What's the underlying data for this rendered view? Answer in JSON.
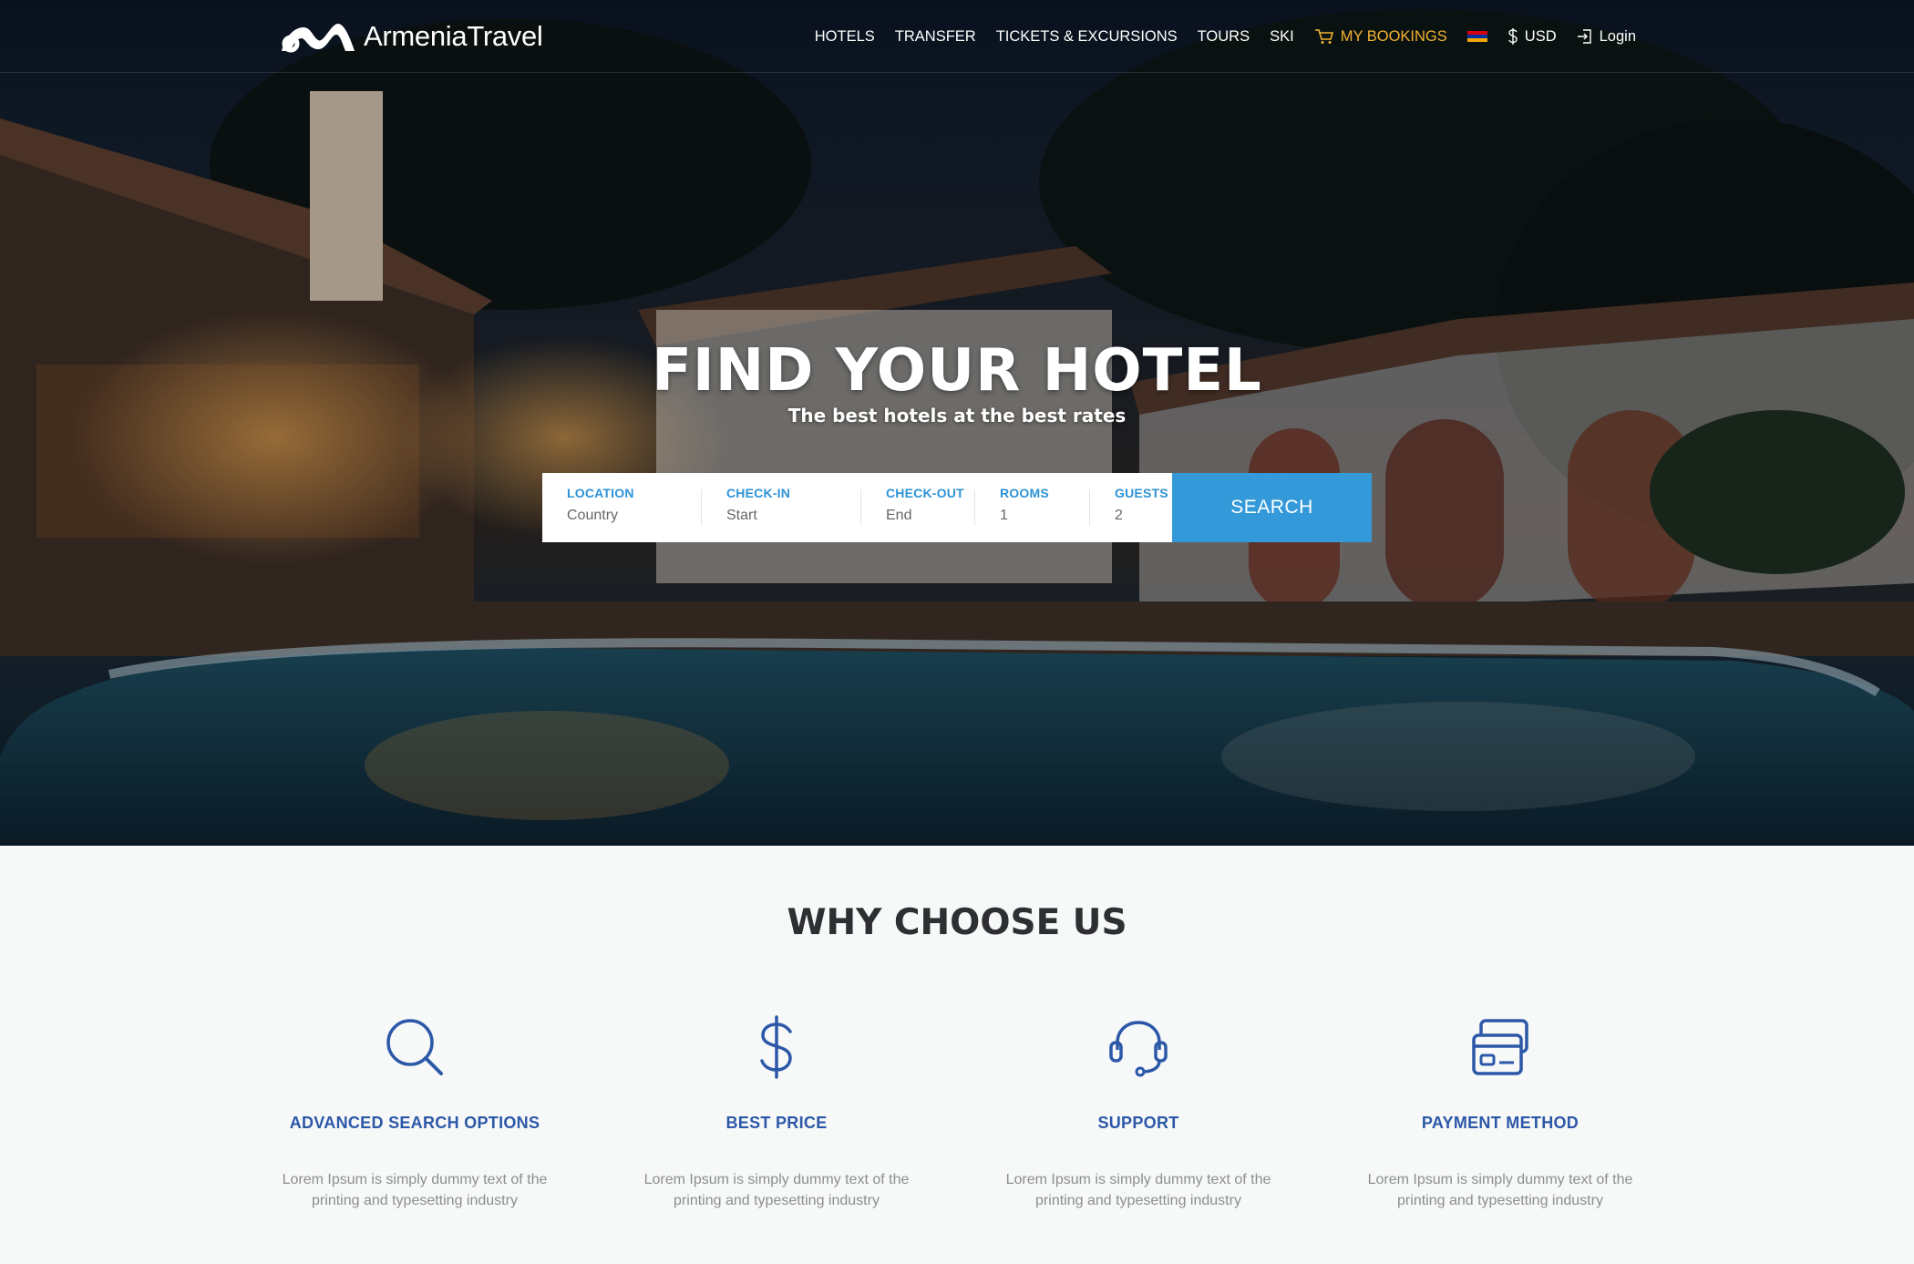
{
  "brand": {
    "name": "ArmeniaTravel"
  },
  "nav": {
    "items": [
      "HOTELS",
      "TRANSFER",
      "TICKETS & EXCURSIONS",
      "TOURS",
      "SKI"
    ],
    "bookings": "MY BOOKINGS",
    "currency": "USD",
    "login": "Login",
    "accent_color": "#f2b233"
  },
  "hero": {
    "title": "FIND YOUR HOTEL",
    "subtitle": "The best hotels at the best rates"
  },
  "search": {
    "fields": [
      {
        "label": "LOCATION",
        "value": "Country"
      },
      {
        "label": "CHECK-IN",
        "value": "Start"
      },
      {
        "label": "CHECK-OUT",
        "value": "End"
      },
      {
        "label": "ROOMS",
        "value": "1"
      },
      {
        "label": "GUESTS",
        "value": "2"
      }
    ],
    "button": "SEARCH",
    "accent_color": "#3399d8"
  },
  "why": {
    "title": "WHY CHOOSE US",
    "features": [
      {
        "icon": "search-icon",
        "title": "ADVANCED SEARCH OPTIONS",
        "text": "Lorem Ipsum is simply dummy text of the printing and typesetting industry"
      },
      {
        "icon": "dollar-icon",
        "title": "BEST PRICE",
        "text": "Lorem Ipsum is simply dummy text of the printing and typesetting industry"
      },
      {
        "icon": "headset-icon",
        "title": "SUPPORT",
        "text": "Lorem Ipsum is simply dummy text of the printing and typesetting industry"
      },
      {
        "icon": "credit-card-icon",
        "title": "PAYMENT METHOD",
        "text": "Lorem Ipsum is simply dummy text of the printing and typesetting industry"
      }
    ],
    "accent_color": "#2c58a8"
  }
}
